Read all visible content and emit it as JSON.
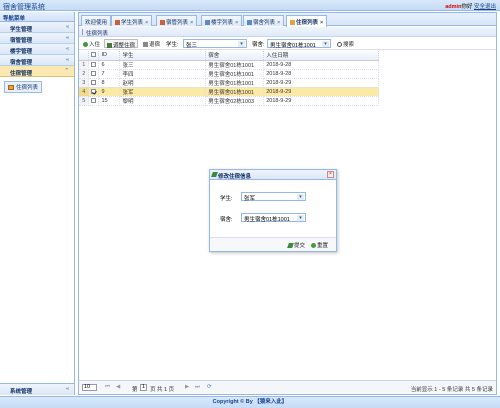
{
  "header": {
    "title": "宿舍管理系统",
    "user": "admin",
    "greeting": "你好",
    "logout": "安全退出"
  },
  "nav": {
    "title": "导航菜单",
    "collapse_icon": "«",
    "items": [
      {
        "label": "学生管理",
        "icon": "chevron-left-icon",
        "chev": "«"
      },
      {
        "label": "宿管管理",
        "icon": "chevron-left-icon",
        "chev": "«"
      },
      {
        "label": "楼宇管理",
        "icon": "chevron-left-icon",
        "chev": "«"
      },
      {
        "label": "宿舍管理",
        "icon": "chevron-left-icon",
        "chev": "«"
      },
      {
        "label": "住宿管理",
        "icon": "chevron-up-icon",
        "chev": "⌃"
      }
    ],
    "sub_link": "住宿列表",
    "bottom_item": {
      "label": "系统管理",
      "chev": "«"
    }
  },
  "tabs": [
    {
      "label": "欢迎使用",
      "closable": false
    },
    {
      "label": "学生列表",
      "closable": true,
      "x": "×"
    },
    {
      "label": "宿管列表",
      "closable": true,
      "x": "×"
    },
    {
      "label": "楼宇列表",
      "closable": true,
      "x": "×"
    },
    {
      "label": "宿舍列表",
      "closable": true,
      "x": "×"
    },
    {
      "label": "住宿列表",
      "closable": true,
      "x": "×",
      "active": true
    }
  ],
  "panel": {
    "title": "住宿列表"
  },
  "toolbar": {
    "add": "入住",
    "edit": "调整住宿",
    "remove": "退宿",
    "student_label": "学生:",
    "student_value": "张三",
    "dorm_label": "宿舍:",
    "dorm_value": "男生宿舍01栋1001",
    "search": "搜索",
    "dropdown_arrow": "▾"
  },
  "grid": {
    "columns": [
      "ID",
      "学生",
      "宿舍",
      "入住日期"
    ],
    "rows": [
      {
        "n": "1",
        "checked": false,
        "id": "6",
        "student": "张三",
        "dorm": "男生宿舍01栋1001",
        "date": "2018-9-28"
      },
      {
        "n": "2",
        "checked": false,
        "id": "7",
        "student": "李四",
        "dorm": "男生宿舍01栋1001",
        "date": "2018-9-28"
      },
      {
        "n": "3",
        "checked": false,
        "id": "8",
        "student": "赵明",
        "dorm": "男生宿舍01栋1001",
        "date": "2018-9-29"
      },
      {
        "n": "4",
        "checked": true,
        "id": "9",
        "student": "张军",
        "dorm": "男生宿舍01栋1001",
        "date": "2018-9-29"
      },
      {
        "n": "5",
        "checked": false,
        "id": "15",
        "student": "黎明",
        "dorm": "男生宿舍02栋1003",
        "date": "2018-9-29"
      }
    ]
  },
  "pager": {
    "page_size": "10",
    "first": "⏮",
    "prev": "◀",
    "page_prefix": "第",
    "page": "1",
    "page_suffix": "页 共 1 页",
    "next": "▶",
    "last": "⏭",
    "refresh": "⟳",
    "info": "当前显示 1 - 5 条记录 共 5 条记录"
  },
  "dialog": {
    "title": "修改住宿信息",
    "close": "×",
    "student_label": "学生:",
    "student_value": "张军",
    "dorm_label": "宿舍:",
    "dorm_value": "男生宿舍01栋1001",
    "submit": "提交",
    "reset": "重置"
  },
  "footer": {
    "text": "Copyright © By 【猿来入此】"
  },
  "colors": {
    "accent": "#95b8e7",
    "selected_row": "#fbe9a6",
    "brand_red": "#dd0000"
  }
}
